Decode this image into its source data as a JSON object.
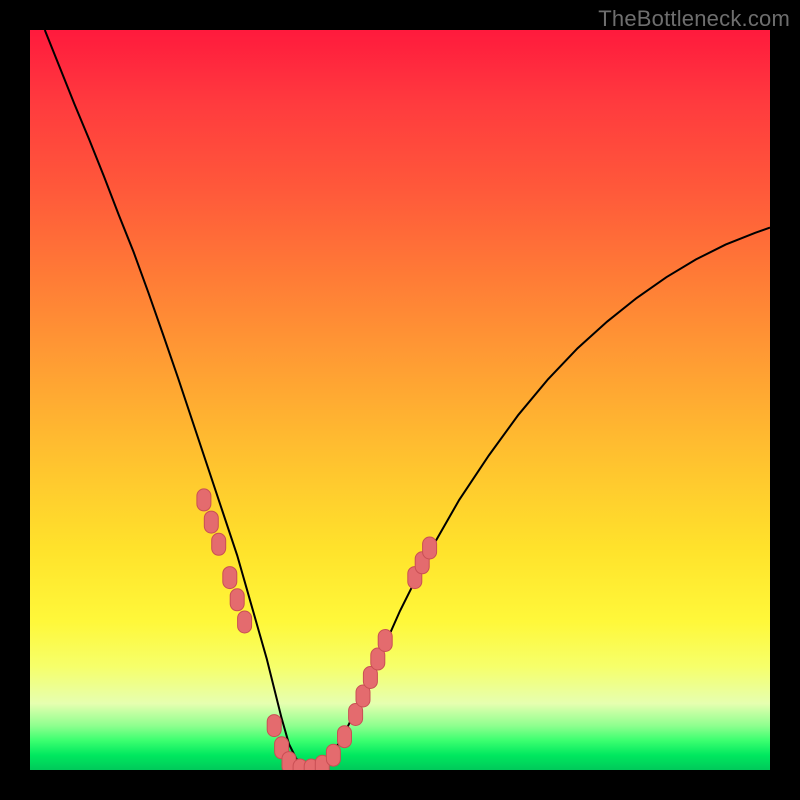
{
  "watermark": "TheBottleneck.com",
  "colors": {
    "curve_stroke": "#000000",
    "marker_fill": "#e46b6e",
    "marker_stroke": "#c94f54"
  },
  "chart_data": {
    "type": "line",
    "title": "",
    "xlabel": "",
    "ylabel": "",
    "xlim": [
      0,
      100
    ],
    "ylim": [
      0,
      100
    ],
    "grid": false,
    "legend": false,
    "curve": {
      "name": "bottleneck-curve",
      "x": [
        2,
        4,
        6,
        8,
        10,
        12,
        14,
        16,
        18,
        20,
        22,
        24,
        26,
        28,
        30,
        31,
        32,
        33,
        34,
        35,
        36,
        37,
        38,
        40,
        42,
        44,
        46,
        48,
        50,
        54,
        58,
        62,
        66,
        70,
        74,
        78,
        82,
        86,
        90,
        94,
        98,
        100
      ],
      "y": [
        100,
        95,
        90,
        85.2,
        80.2,
        75,
        70,
        64.5,
        58.8,
        53,
        47,
        41,
        35,
        29,
        22,
        18.5,
        15,
        11,
        7,
        3.5,
        1.5,
        0.4,
        0,
        1.2,
        4,
        8,
        12.5,
        17,
        21.5,
        29.5,
        36.5,
        42.5,
        48,
        52.8,
        57,
        60.6,
        63.8,
        66.6,
        69,
        71,
        72.6,
        73.3
      ]
    },
    "markers": {
      "name": "highlight-segment",
      "points": [
        {
          "x": 23.5,
          "y": 36.5
        },
        {
          "x": 24.5,
          "y": 33.5
        },
        {
          "x": 25.5,
          "y": 30.5
        },
        {
          "x": 27.0,
          "y": 26.0
        },
        {
          "x": 28.0,
          "y": 23.0
        },
        {
          "x": 29.0,
          "y": 20.0
        },
        {
          "x": 33.0,
          "y": 6.0
        },
        {
          "x": 34.0,
          "y": 3.0
        },
        {
          "x": 35.0,
          "y": 1.0
        },
        {
          "x": 36.5,
          "y": 0.0
        },
        {
          "x": 38.0,
          "y": 0.0
        },
        {
          "x": 39.5,
          "y": 0.5
        },
        {
          "x": 41.0,
          "y": 2.0
        },
        {
          "x": 42.5,
          "y": 4.5
        },
        {
          "x": 44.0,
          "y": 7.5
        },
        {
          "x": 45.0,
          "y": 10.0
        },
        {
          "x": 46.0,
          "y": 12.5
        },
        {
          "x": 47.0,
          "y": 15.0
        },
        {
          "x": 48.0,
          "y": 17.5
        },
        {
          "x": 52.0,
          "y": 26.0
        },
        {
          "x": 53.0,
          "y": 28.0
        },
        {
          "x": 54.0,
          "y": 30.0
        }
      ]
    }
  }
}
